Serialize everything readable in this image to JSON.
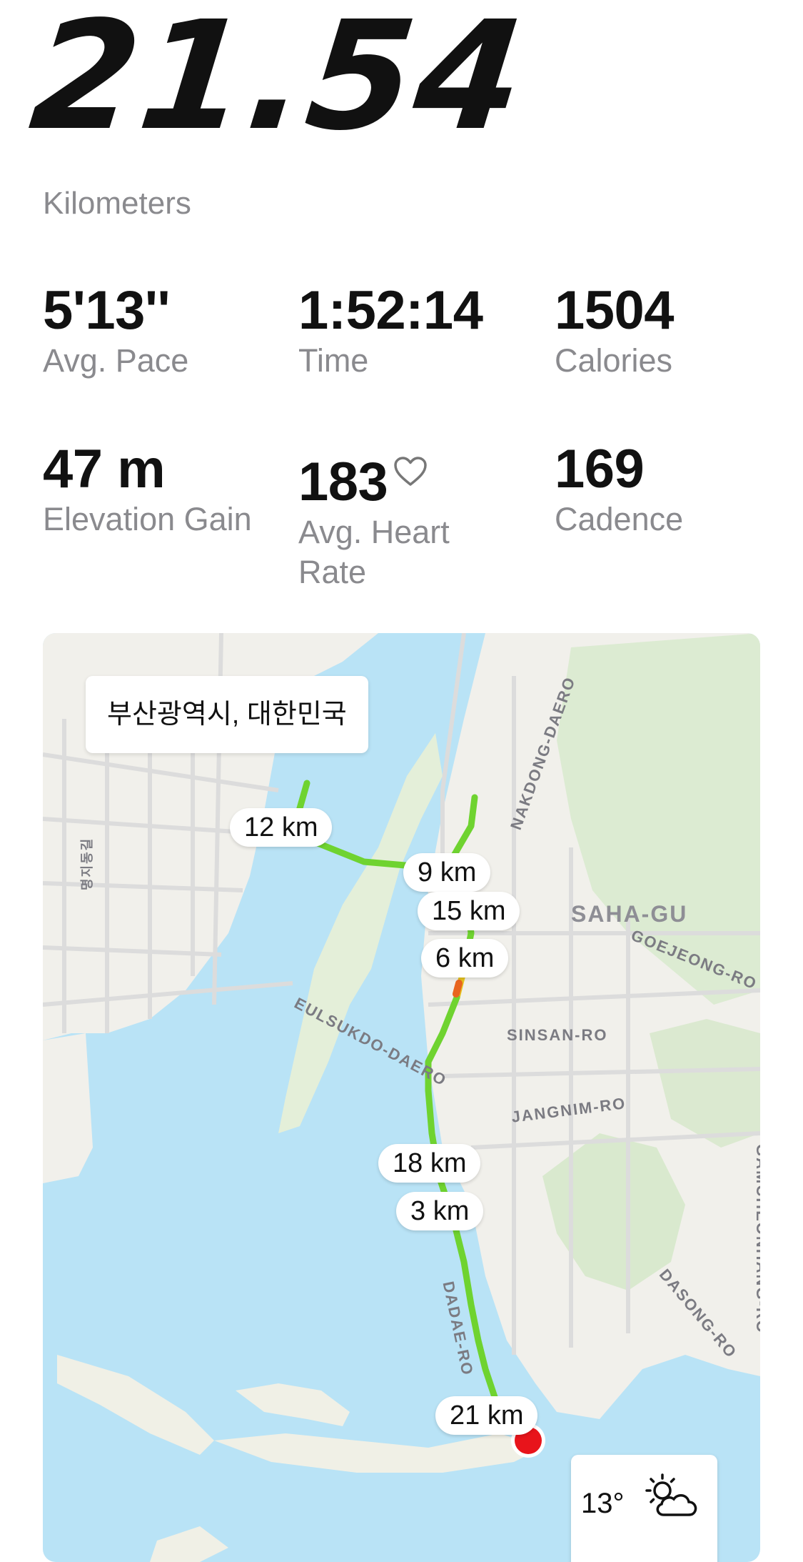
{
  "summary": {
    "distance": "21.54",
    "distance_unit": "Kilometers"
  },
  "stats": [
    {
      "value": "5'13''",
      "label": "Avg. Pace"
    },
    {
      "value": "1:52:14",
      "label": "Time"
    },
    {
      "value": "1504",
      "label": "Calories"
    },
    {
      "value": "47 m",
      "label": "Elevation Gain"
    },
    {
      "value": "183",
      "label": "Avg. Heart Rate",
      "icon": "heart-outline-icon"
    },
    {
      "value": "169",
      "label": "Cadence"
    }
  ],
  "map": {
    "location": "부산광역시, 대한민국",
    "km_markers": [
      "12 km",
      "9 km",
      "15 km",
      "6 km",
      "18 km",
      "3 km",
      "21 km"
    ],
    "place_labels": [
      "SAHA-GU",
      "EULSUKDO-DAERO",
      "SINSAN-RO",
      "JANGNIM-RO",
      "GOEJEONG-RO",
      "NAKDONG-DAERO",
      "DADAE-RO",
      "DASONG-RO",
      "GAMCHEONHANG-RO",
      "명지동길"
    ],
    "route_colors": {
      "normal": "#6fd330",
      "fast": "#e6c21e",
      "fastest": "#e8641e"
    },
    "weather": {
      "temperature": "13°",
      "icon": "partly-cloudy-icon"
    }
  }
}
